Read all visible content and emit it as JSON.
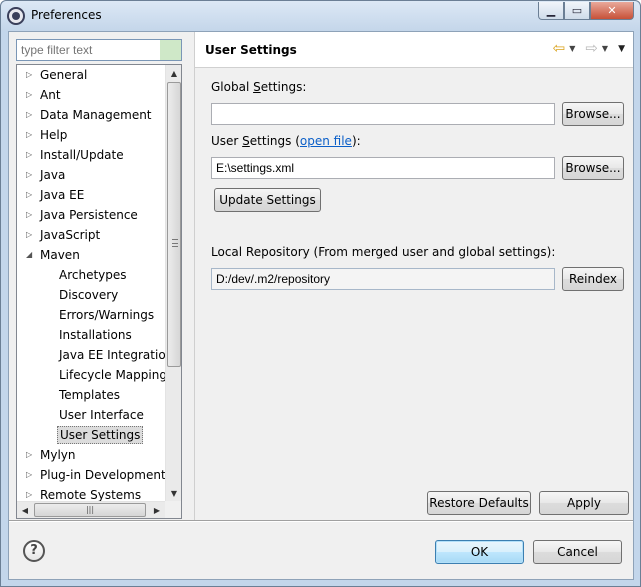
{
  "window": {
    "title": "Preferences"
  },
  "filter": {
    "placeholder": "type filter text"
  },
  "tree": {
    "items": [
      {
        "label": "General",
        "level": 0,
        "expander": "collapsed"
      },
      {
        "label": "Ant",
        "level": 0,
        "expander": "collapsed"
      },
      {
        "label": "Data Management",
        "level": 0,
        "expander": "collapsed"
      },
      {
        "label": "Help",
        "level": 0,
        "expander": "collapsed"
      },
      {
        "label": "Install/Update",
        "level": 0,
        "expander": "collapsed"
      },
      {
        "label": "Java",
        "level": 0,
        "expander": "collapsed"
      },
      {
        "label": "Java EE",
        "level": 0,
        "expander": "collapsed"
      },
      {
        "label": "Java Persistence",
        "level": 0,
        "expander": "collapsed"
      },
      {
        "label": "JavaScript",
        "level": 0,
        "expander": "collapsed"
      },
      {
        "label": "Maven",
        "level": 0,
        "expander": "expanded"
      },
      {
        "label": "Archetypes",
        "level": 1
      },
      {
        "label": "Discovery",
        "level": 1
      },
      {
        "label": "Errors/Warnings",
        "level": 1
      },
      {
        "label": "Installations",
        "level": 1
      },
      {
        "label": "Java EE Integration",
        "level": 1
      },
      {
        "label": "Lifecycle Mappings",
        "level": 1
      },
      {
        "label": "Templates",
        "level": 1
      },
      {
        "label": "User Interface",
        "level": 1
      },
      {
        "label": "User Settings",
        "level": 1,
        "selected": true
      },
      {
        "label": "Mylyn",
        "level": 0,
        "expander": "collapsed"
      },
      {
        "label": "Plug-in Development",
        "level": 0,
        "expander": "collapsed"
      },
      {
        "label": "Remote Systems",
        "level": 0,
        "expander": "collapsed"
      }
    ]
  },
  "page": {
    "title": "User Settings",
    "global_settings": {
      "label_pre": "Global ",
      "label_mnemonic": "S",
      "label_post": "ettings:",
      "value": "",
      "browse_label": "Browse..."
    },
    "user_settings": {
      "label_pre": "User ",
      "label_mnemonic": "S",
      "label_post": "ettings (",
      "link_text": "open file",
      "label_end": "):",
      "value": "E:\\settings.xml",
      "browse_label": "Browse..."
    },
    "update_label": "Update Settings",
    "local_repo": {
      "label": "Local Repository (From merged user and global settings):",
      "value": "D:/dev/.m2/repository",
      "reindex_label": "Reindex"
    },
    "restore_defaults_label": "Restore Defaults",
    "apply_label": "Apply"
  },
  "dialog": {
    "ok_label": "OK",
    "cancel_label": "Cancel",
    "help_glyph": "?"
  }
}
